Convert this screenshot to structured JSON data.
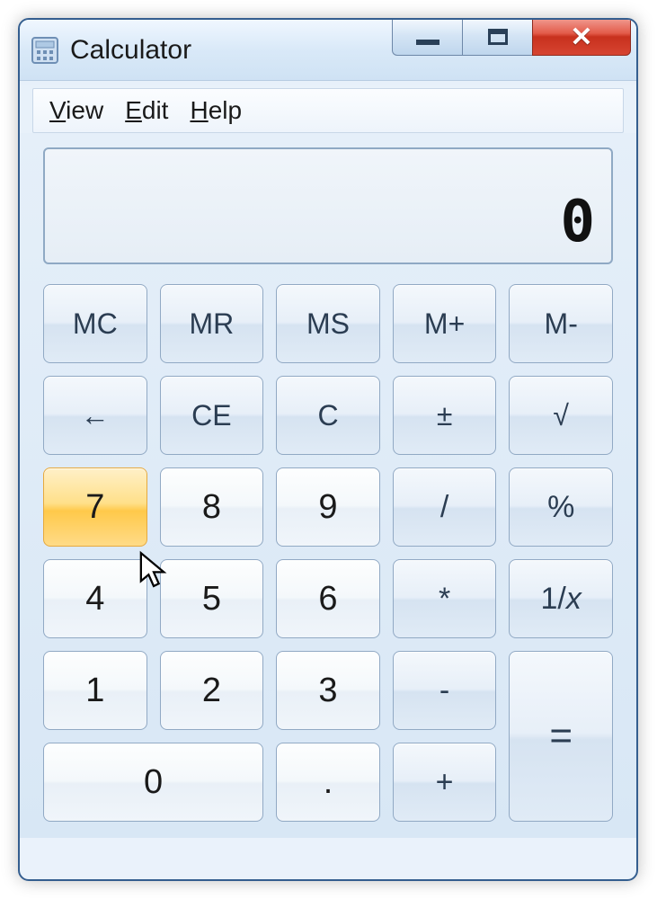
{
  "window": {
    "title": "Calculator"
  },
  "menu": {
    "view": "View",
    "edit": "Edit",
    "help": "Help"
  },
  "display": {
    "value": "0"
  },
  "keys": {
    "mc": "MC",
    "mr": "MR",
    "ms": "MS",
    "mplus": "M+",
    "mminus": "M-",
    "back": "←",
    "ce": "CE",
    "c": "C",
    "negate": "±",
    "sqrt": "√",
    "d7": "7",
    "d8": "8",
    "d9": "9",
    "div": "/",
    "pct": "%",
    "d4": "4",
    "d5": "5",
    "d6": "6",
    "mul": "*",
    "recip": "1/x",
    "d1": "1",
    "d2": "2",
    "d3": "3",
    "sub": "-",
    "eq": "=",
    "d0": "0",
    "dec": ".",
    "add": "+"
  }
}
